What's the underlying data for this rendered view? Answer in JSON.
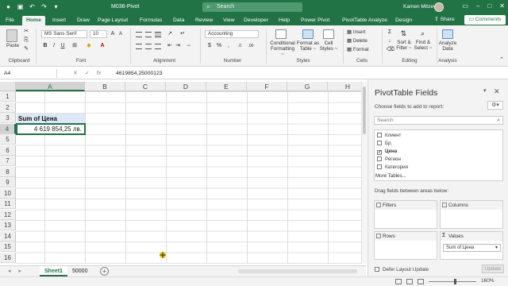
{
  "window": {
    "doc_title": "M036-Pivot",
    "search_placeholder": "Search",
    "user_name": "Kamen Mitzev"
  },
  "ribbon_tabs": [
    "File",
    "Home",
    "Insert",
    "Draw",
    "Page Layout",
    "Formulas",
    "Data",
    "Review",
    "View",
    "Developer",
    "Help",
    "Power Pivot",
    "PivotTable Analyze",
    "Design"
  ],
  "ribbon_actions": {
    "share": "Share",
    "comments": "Comments"
  },
  "ribbon": {
    "clipboard": {
      "paste": "Paste",
      "label": "Clipboard"
    },
    "font": {
      "name": "MS Sans Serif",
      "size": "10",
      "label": "Font"
    },
    "alignment": {
      "label": "Alignment"
    },
    "number": {
      "format": "Accounting",
      "label": "Number"
    },
    "styles": {
      "conditional": "Conditional Formatting ~",
      "format_table": "Format as Table ~",
      "cell_styles": "Cell Styles ~",
      "label": "Styles"
    },
    "cells": {
      "insert": "Insert",
      "delete": "Delete",
      "format": "Format",
      "label": "Cells"
    },
    "editing": {
      "sort": "Sort &",
      "filter": "Filter ~",
      "find": "Find &",
      "select": "Select ~",
      "label": "Editing"
    },
    "analysis": {
      "analyze": "Analyze",
      "data": "Data",
      "label": "Analysis"
    }
  },
  "formula_bar": {
    "name_box": "A4",
    "fx": "fx",
    "content": "4619854,25000123"
  },
  "grid": {
    "columns": [
      "A",
      "B",
      "C",
      "D",
      "E",
      "F",
      "G",
      "H"
    ],
    "rows": [
      "1",
      "2",
      "3",
      "4",
      "5",
      "6",
      "7",
      "8",
      "9",
      "10",
      "11",
      "12",
      "13",
      "14",
      "15",
      "16"
    ],
    "cells": {
      "a3": "Sum of Цена",
      "a4": "4 619 854,25 лв."
    }
  },
  "sheets": {
    "tabs": [
      "Sheet1",
      "50000"
    ],
    "active": "Sheet1"
  },
  "status": {
    "zoom": "160%"
  },
  "pivot_pane": {
    "title": "PivotTable Fields",
    "subtitle": "Choose fields to add to report:",
    "search_placeholder": "Search",
    "fields": [
      {
        "name": "Клиент",
        "checked": false
      },
      {
        "name": "Бр.",
        "checked": false
      },
      {
        "name": "Цена",
        "checked": true
      },
      {
        "name": "Регион",
        "checked": false
      },
      {
        "name": "Категория",
        "checked": false
      }
    ],
    "more_tables": "More Tables...",
    "drag_label": "Drag fields between areas below:",
    "areas": {
      "filters": "Filters",
      "columns": "Columns",
      "rows": "Rows",
      "values": "Values",
      "values_chip": "Sum of Цена"
    },
    "defer": "Defer Layout Update",
    "update": "Update"
  },
  "colors": {
    "excel_green": "#217346",
    "pivot_header_fill": "#dde7f5"
  }
}
